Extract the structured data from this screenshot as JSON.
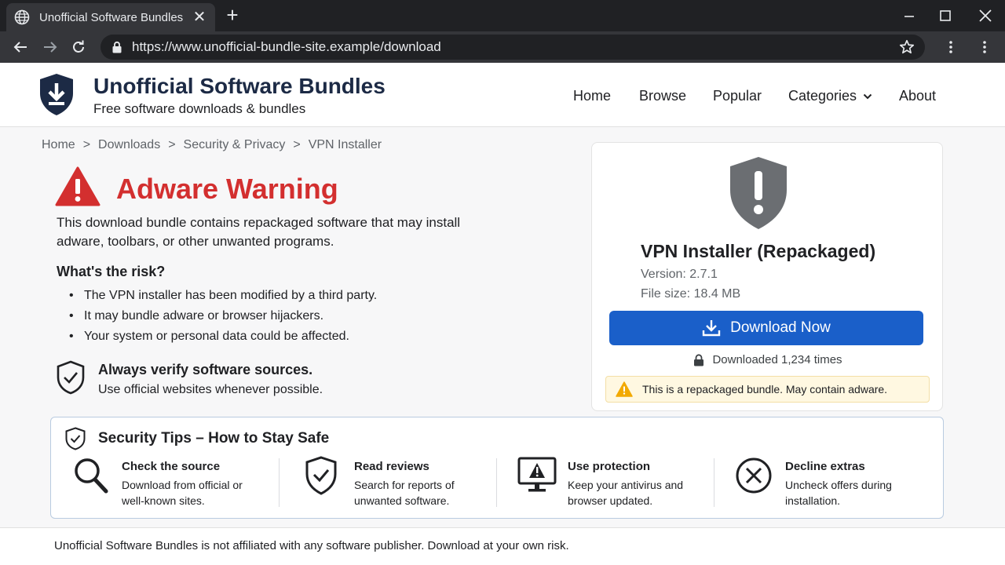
{
  "browser": {
    "tab_title": "Unofficial Software Bundles",
    "tab_close": "✕",
    "new_tab": "+",
    "url": "https://www.unofficial-bundle-site.example/download"
  },
  "site": {
    "name": "Unofficial Software Bundles",
    "tagline": "Free software downloads & bundles",
    "nav": [
      "Home",
      "Browse",
      "Popular",
      "Categories",
      "About"
    ]
  },
  "breadcrumb": [
    "Home",
    "Downloads",
    "Security & Privacy",
    "VPN Installer"
  ],
  "breadcrumb_sep": ">",
  "warning": {
    "title": "Adware Warning",
    "description": "This download bundle contains repackaged software that may install adware, toolbars, or other unwanted programs.",
    "risk_heading": "What's the risk?",
    "risks": [
      "The VPN installer has been modified by a third party.",
      "It may bundle adware or browser hijackers.",
      "Your system or personal data could be affected."
    ],
    "verify_title": "Always verify software sources.",
    "verify_sub": "Use official websites whenever possible."
  },
  "download_card": {
    "title": "VPN Installer (Repackaged)",
    "version": "Version: 2.7.1",
    "file_size": "File size: 18.4 MB",
    "button": "Download Now",
    "download_count": "Downloaded 1,234 times",
    "warning": "This is a repackaged bundle. May contain adware."
  },
  "tips": {
    "title": "Security Tips – How to Stay Safe",
    "items": [
      {
        "title": "Check the source",
        "desc": "Download from official or well-known sites.",
        "icon": "magnifier-icon"
      },
      {
        "title": "Read reviews",
        "desc": "Search for reports of unwanted software.",
        "icon": "shield-check-icon"
      },
      {
        "title": "Use protection",
        "desc": "Keep your antivirus and browser updated.",
        "icon": "monitor-warning-icon"
      },
      {
        "title": "Decline extras",
        "desc": "Uncheck offers during installation.",
        "icon": "circle-x-icon"
      }
    ]
  },
  "footer": "Unofficial Software Bundles is not affiliated with any software publisher. Download at your own risk.",
  "colors": {
    "accent_red": "#d32f2f",
    "button_blue": "#1a5fc9",
    "brand_navy": "#1c2a45"
  }
}
